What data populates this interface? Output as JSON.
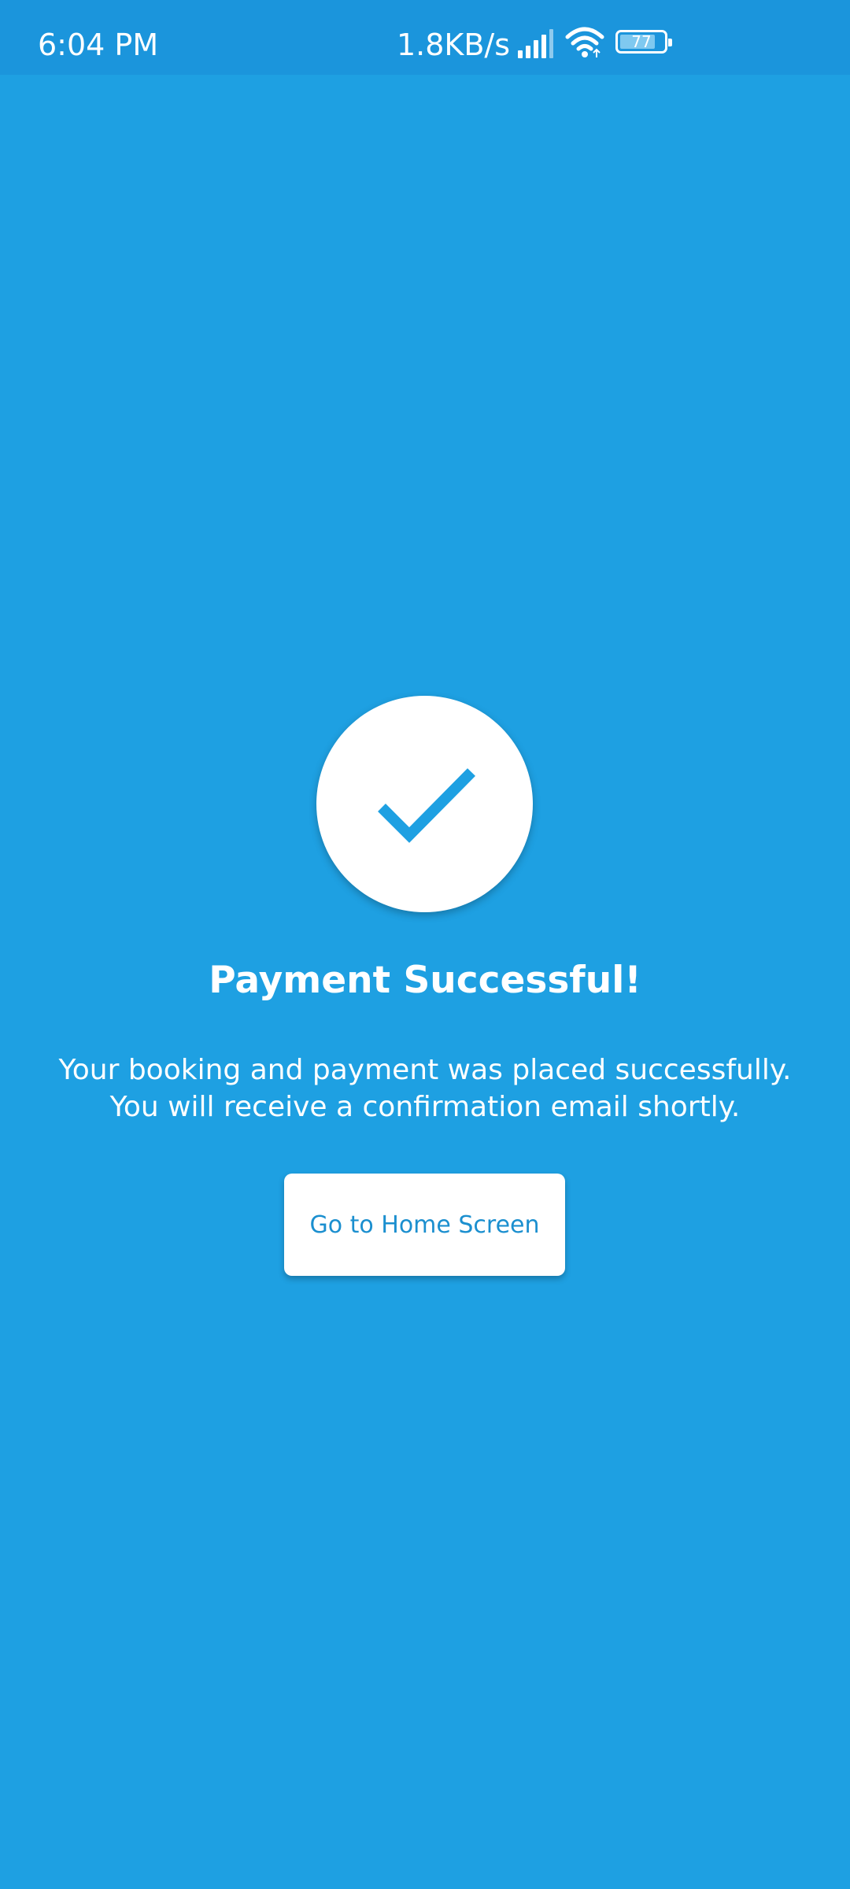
{
  "status_bar": {
    "time": "6:04 PM",
    "network_speed": "1.8KB/s",
    "signal_icon": "signal-icon",
    "wifi_icon": "wifi-icon",
    "battery_level": "77"
  },
  "main": {
    "icon": "check-icon",
    "title": "Payment Successful!",
    "message_lines": [
      "Your booking and payment was placed successfully.",
      "You will receive a confirmation email shortly."
    ],
    "home_button_label": "Go to Home Screen"
  },
  "colors": {
    "background": "#1ea0e2",
    "status_bar": "#1b95dc",
    "accent": "#1ea0e2",
    "button_text": "#1b8fcf",
    "surface": "#ffffff"
  }
}
